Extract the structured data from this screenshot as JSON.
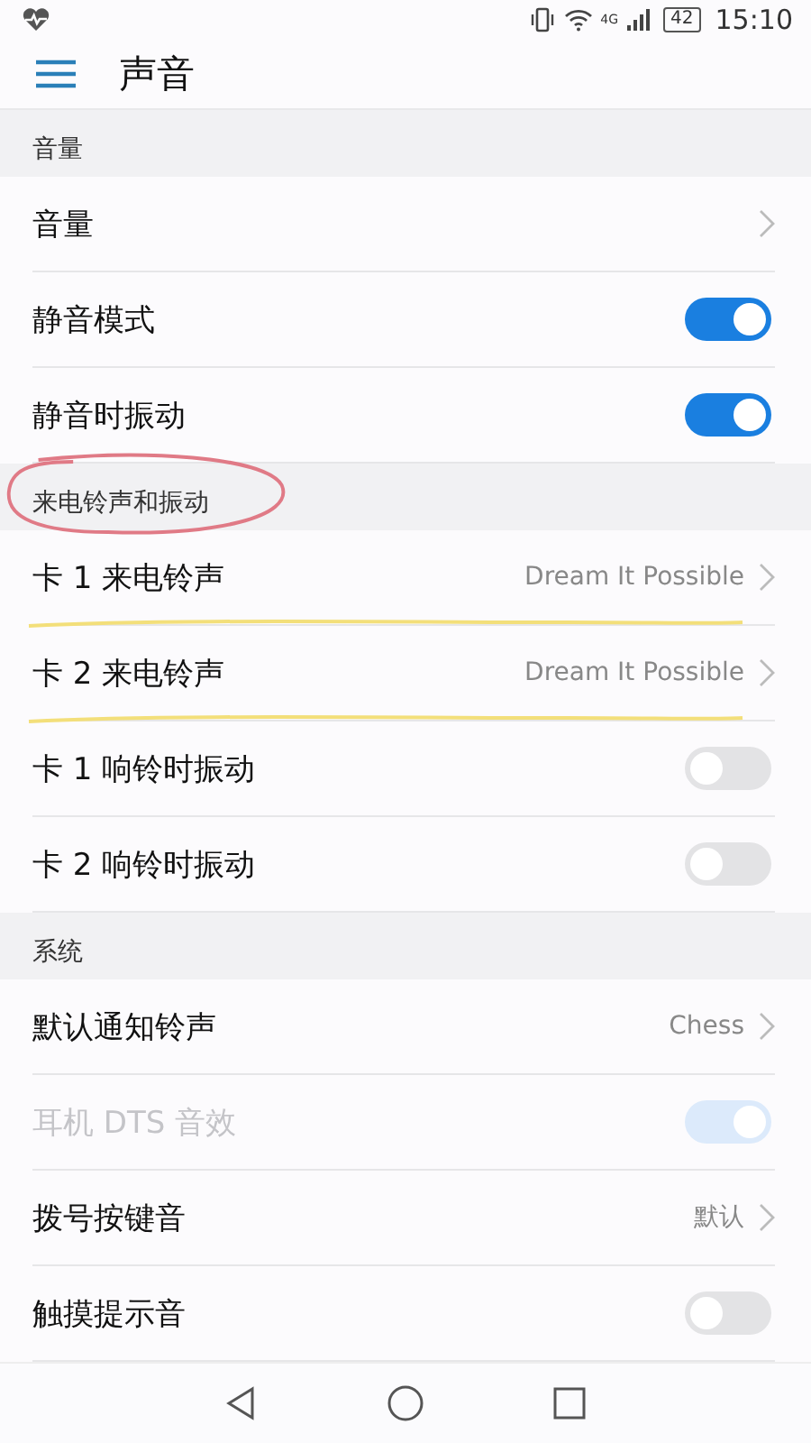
{
  "status_bar": {
    "network": "4G",
    "battery": "42",
    "time": "15:10"
  },
  "header": {
    "title": "声音"
  },
  "sections": [
    {
      "title": "音量",
      "circled": false,
      "rows": [
        {
          "kind": "link",
          "label": "音量",
          "underlined": false
        },
        {
          "kind": "toggle",
          "label": "静音模式",
          "on": true,
          "disabled": false,
          "underlined": false
        },
        {
          "kind": "toggle",
          "label": "静音时振动",
          "on": true,
          "disabled": false,
          "underlined": false
        }
      ]
    },
    {
      "title": "来电铃声和振动",
      "circled": true,
      "rows": [
        {
          "kind": "link",
          "label": "卡 1 来电铃声",
          "value": "Dream It Possible",
          "underlined": true
        },
        {
          "kind": "link",
          "label": "卡 2 来电铃声",
          "value": "Dream It Possible",
          "underlined": true
        },
        {
          "kind": "toggle",
          "label": "卡 1 响铃时振动",
          "on": false,
          "disabled": false,
          "underlined": false
        },
        {
          "kind": "toggle",
          "label": "卡 2 响铃时振动",
          "on": false,
          "disabled": false,
          "underlined": false
        }
      ]
    },
    {
      "title": "系统",
      "circled": false,
      "rows": [
        {
          "kind": "link",
          "label": "默认通知铃声",
          "value": "Chess",
          "underlined": false
        },
        {
          "kind": "toggle",
          "label": "耳机 DTS 音效",
          "on": true,
          "disabled": true,
          "underlined": false
        },
        {
          "kind": "link",
          "label": "拨号按键音",
          "value": "默认",
          "underlined": false
        },
        {
          "kind": "toggle",
          "label": "触摸提示音",
          "on": false,
          "disabled": false,
          "underlined": false
        }
      ]
    }
  ]
}
